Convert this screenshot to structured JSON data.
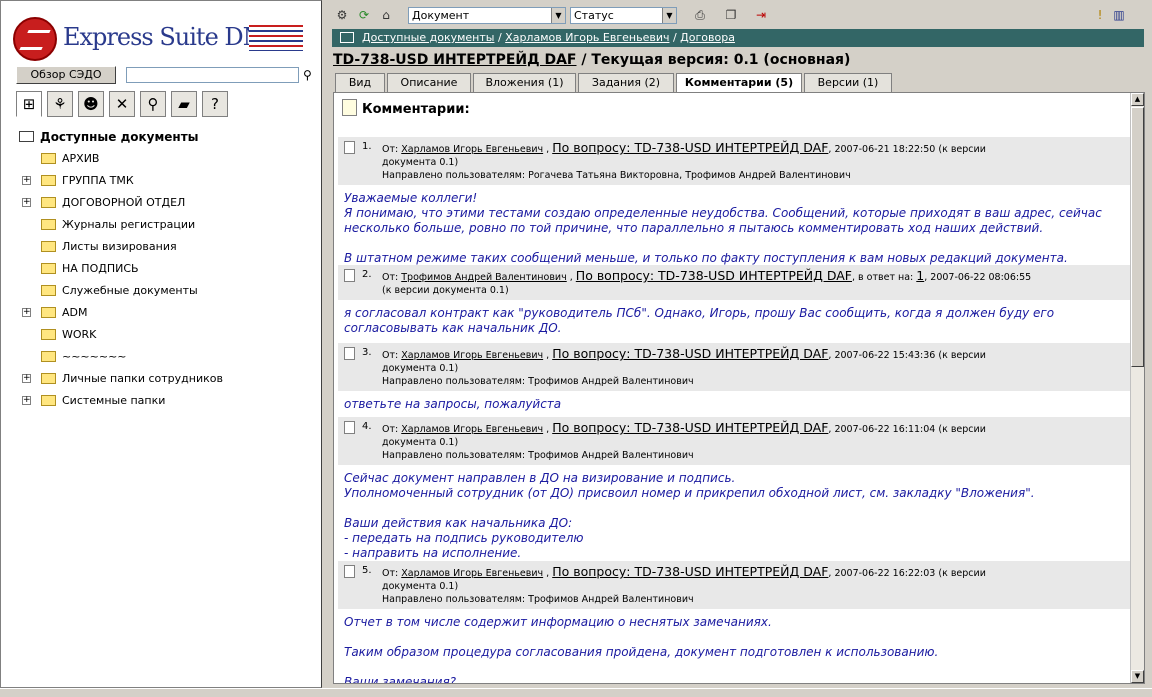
{
  "app": {
    "logo_text": "Express Suite DMS"
  },
  "left": {
    "browse_button": "Обзор СЭДО",
    "search_value": "",
    "tab_icons": [
      "tree-icon",
      "workflow-icon",
      "users-icon",
      "tools-icon",
      "search-icon",
      "book-icon",
      "help-icon"
    ],
    "tree_root": "Доступные документы",
    "tree_items": [
      {
        "label": "АРХИВ",
        "expandable": false
      },
      {
        "label": "ГРУППА ТМК",
        "expandable": true
      },
      {
        "label": "ДОГОВОРНОЙ ОТДЕЛ",
        "expandable": true
      },
      {
        "label": "Журналы регистрации",
        "expandable": false
      },
      {
        "label": "Листы визирования",
        "expandable": false
      },
      {
        "label": "НА ПОДПИСЬ",
        "expandable": false
      },
      {
        "label": "Служебные документы",
        "expandable": false
      },
      {
        "label": "ADM",
        "expandable": true
      },
      {
        "label": "WORK",
        "expandable": false
      },
      {
        "label": "~~~~~~~",
        "expandable": false
      },
      {
        "label": "Личные папки сотрудников",
        "expandable": true
      },
      {
        "label": "Системные папки",
        "expandable": true
      }
    ]
  },
  "toolbar": {
    "type_select": "Документ",
    "status_select": "Статус"
  },
  "breadcrumb": {
    "items": [
      "Доступные документы",
      "Харламов Игорь Евгеньевич",
      "Договора"
    ],
    "sep": " / "
  },
  "document": {
    "title_link": "TD-738-USD ИНТЕРТРЕЙД DAF",
    "title_rest": " / Текущая версия: 0.1 (основная)"
  },
  "tabs": [
    "Вид",
    "Описание",
    "Вложения (1)",
    "Задания (2)",
    "Комментарии (5)",
    "Версии (1)"
  ],
  "active_tab": 4,
  "comments_header": "Комментарии:",
  "labels": {
    "from": "От:",
    "directed": "Направлено пользователям:",
    "regarding": "По вопросу: TD-738-USD ИНТЕРТРЕЙД DAF",
    "reply_to": "в ответ на:"
  },
  "comments": [
    {
      "num": "1.",
      "author": "Харламов Игорь Евгеньевич",
      "date": "2007-06-21 18:22:50 (к версии",
      "ver": "документа 0.1)",
      "to": "Рогачева Татьяна Викторовна, Трофимов Андрей Валентинович",
      "reply": "",
      "text": "Уважаемые коллеги!\nЯ понимаю, что этими тестами создаю определенные неудобства. Сообщений, которые приходят в ваш адрес, сейчас\nнесколько больше, ровно по той причине, что параллельно я пытаюсь комментировать ход наших действий.\n\nВ штатном режиме таких сообщений меньше, и только по факту поступления к вам новых редакций документа."
    },
    {
      "num": "2.",
      "author": "Трофимов Андрей Валентинович",
      "date": "2007-06-22 08:06:55",
      "ver": "(к версии документа 0.1)",
      "to": "",
      "reply": "1",
      "text": "я согласовал контракт как \"руководитель ПСб\". Однако, Игорь, прошу Вас сообщить, когда я должен буду его\nсогласовывать как начальник ДО."
    },
    {
      "num": "3.",
      "author": "Харламов Игорь Евгеньевич",
      "date": "2007-06-22 15:43:36 (к версии",
      "ver": "документа 0.1)",
      "to": "Трофимов Андрей Валентинович",
      "reply": "",
      "text": "ответьте на запросы, пожалуйста"
    },
    {
      "num": "4.",
      "author": "Харламов Игорь Евгеньевич",
      "date": "2007-06-22 16:11:04 (к версии",
      "ver": "документа 0.1)",
      "to": "Трофимов Андрей Валентинович",
      "reply": "",
      "text": "Сейчас документ направлен в ДО на визирование и подпись.\nУполномоченный сотрудник (от ДО) присвоил номер и прикрепил обходной лист, см. закладку \"Вложения\".\n\nВаши действия как начальника ДО:\n- передать на подпись руководителю\n- направить на исполнение."
    },
    {
      "num": "5.",
      "author": "Харламов Игорь Евгеньевич",
      "date": "2007-06-22 16:22:03 (к версии",
      "ver": "документа 0.1)",
      "to": "Трофимов Андрей Валентинович",
      "reply": "",
      "text": "Отчет в том числе содержит информацию о неснятых замечаниях.\n\nТаким образом процедура согласования пройдена, документ подготовлен к использованию.\n\nВаши замечания?"
    }
  ]
}
